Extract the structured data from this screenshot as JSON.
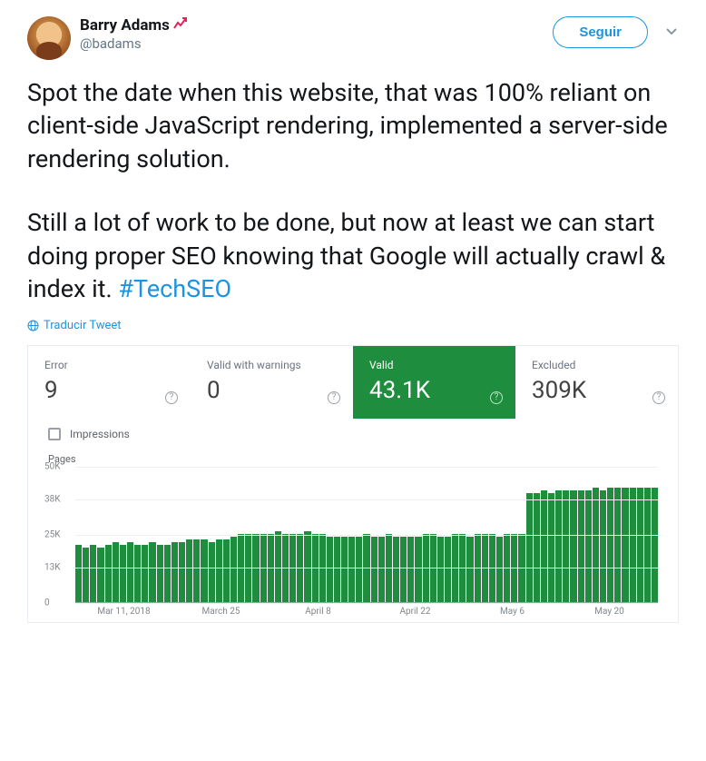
{
  "header": {
    "display_name": "Barry Adams",
    "handle": "@badams",
    "follow_label": "Seguir"
  },
  "tweet": {
    "para1": "Spot the date when this website, that was 100% reliant on client-side JavaScript rendering, implemented a server-side rendering solution.",
    "para2": "Still a lot of work to be done, but now at least we can start doing proper SEO knowing that Google will actually crawl & index it. ",
    "hashtag": "#TechSEO",
    "translate_label": "Traducir Tweet"
  },
  "stats": {
    "error_label": "Error",
    "error_value": "9",
    "warn_label": "Valid with warnings",
    "warn_value": "0",
    "valid_label": "Valid",
    "valid_value": "43.1K",
    "excluded_label": "Excluded",
    "excluded_value": "309K"
  },
  "impressions_label": "Impressions",
  "chart_data": {
    "type": "bar",
    "title": "Pages",
    "xlabel": "",
    "ylabel": "Pages",
    "ylim": [
      0,
      50
    ],
    "yticks_labels": [
      "50K",
      "38K",
      "25K",
      "13K",
      "0"
    ],
    "yticks_values": [
      50,
      38,
      25,
      13,
      0
    ],
    "xticks": [
      "Mar 11, 2018",
      "March 25",
      "April 8",
      "April 22",
      "May 6",
      "May 20"
    ],
    "values": [
      21,
      20,
      21,
      20,
      21,
      22,
      21,
      22,
      21,
      21,
      22,
      21,
      21,
      22,
      22,
      23,
      23,
      23,
      22,
      23,
      23,
      24,
      25,
      25,
      25,
      25,
      25,
      26,
      25,
      25,
      25,
      26,
      25,
      25,
      24,
      24,
      24,
      24,
      24,
      25,
      24,
      24,
      25,
      24,
      24,
      24,
      24,
      25,
      25,
      24,
      24,
      25,
      25,
      24,
      25,
      25,
      25,
      24,
      25,
      25,
      25,
      40,
      40,
      41,
      40,
      41,
      41,
      41,
      41,
      41,
      42,
      41,
      42,
      42,
      42,
      42,
      42,
      42,
      42
    ]
  }
}
